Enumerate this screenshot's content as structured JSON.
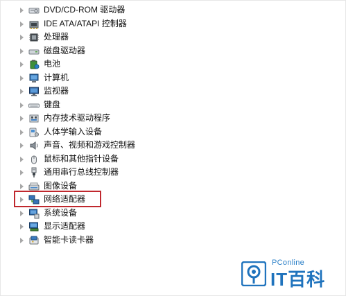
{
  "tree": {
    "items": [
      {
        "label": "DVD/CD-ROM 驱动器",
        "icon": "dvd-drive-icon"
      },
      {
        "label": "IDE ATA/ATAPI 控制器",
        "icon": "ide-controller-icon"
      },
      {
        "label": "处理器",
        "icon": "processor-icon"
      },
      {
        "label": "磁盘驱动器",
        "icon": "disk-drive-icon"
      },
      {
        "label": "电池",
        "icon": "battery-icon"
      },
      {
        "label": "计算机",
        "icon": "computer-icon"
      },
      {
        "label": "监视器",
        "icon": "monitor-icon"
      },
      {
        "label": "键盘",
        "icon": "keyboard-icon"
      },
      {
        "label": "内存技术驱动程序",
        "icon": "memory-driver-icon"
      },
      {
        "label": "人体学输入设备",
        "icon": "hid-icon"
      },
      {
        "label": "声音、视频和游戏控制器",
        "icon": "sound-icon"
      },
      {
        "label": "鼠标和其他指针设备",
        "icon": "mouse-icon"
      },
      {
        "label": "通用串行总线控制器",
        "icon": "usb-icon"
      },
      {
        "label": "图像设备",
        "icon": "imaging-device-icon"
      },
      {
        "label": "网络适配器",
        "icon": "network-adapter-icon",
        "highlighted": true
      },
      {
        "label": "系统设备",
        "icon": "system-device-icon"
      },
      {
        "label": "显示适配器",
        "icon": "display-adapter-icon"
      },
      {
        "label": "智能卡读卡器",
        "icon": "smart-card-reader-icon"
      }
    ]
  },
  "watermark": {
    "brand": "PConline",
    "name": "IT百科",
    "logo_icon": "pconline-logo-icon"
  },
  "colors": {
    "highlight_border": "#c0282e",
    "watermark_blue": "#1f73bd"
  }
}
